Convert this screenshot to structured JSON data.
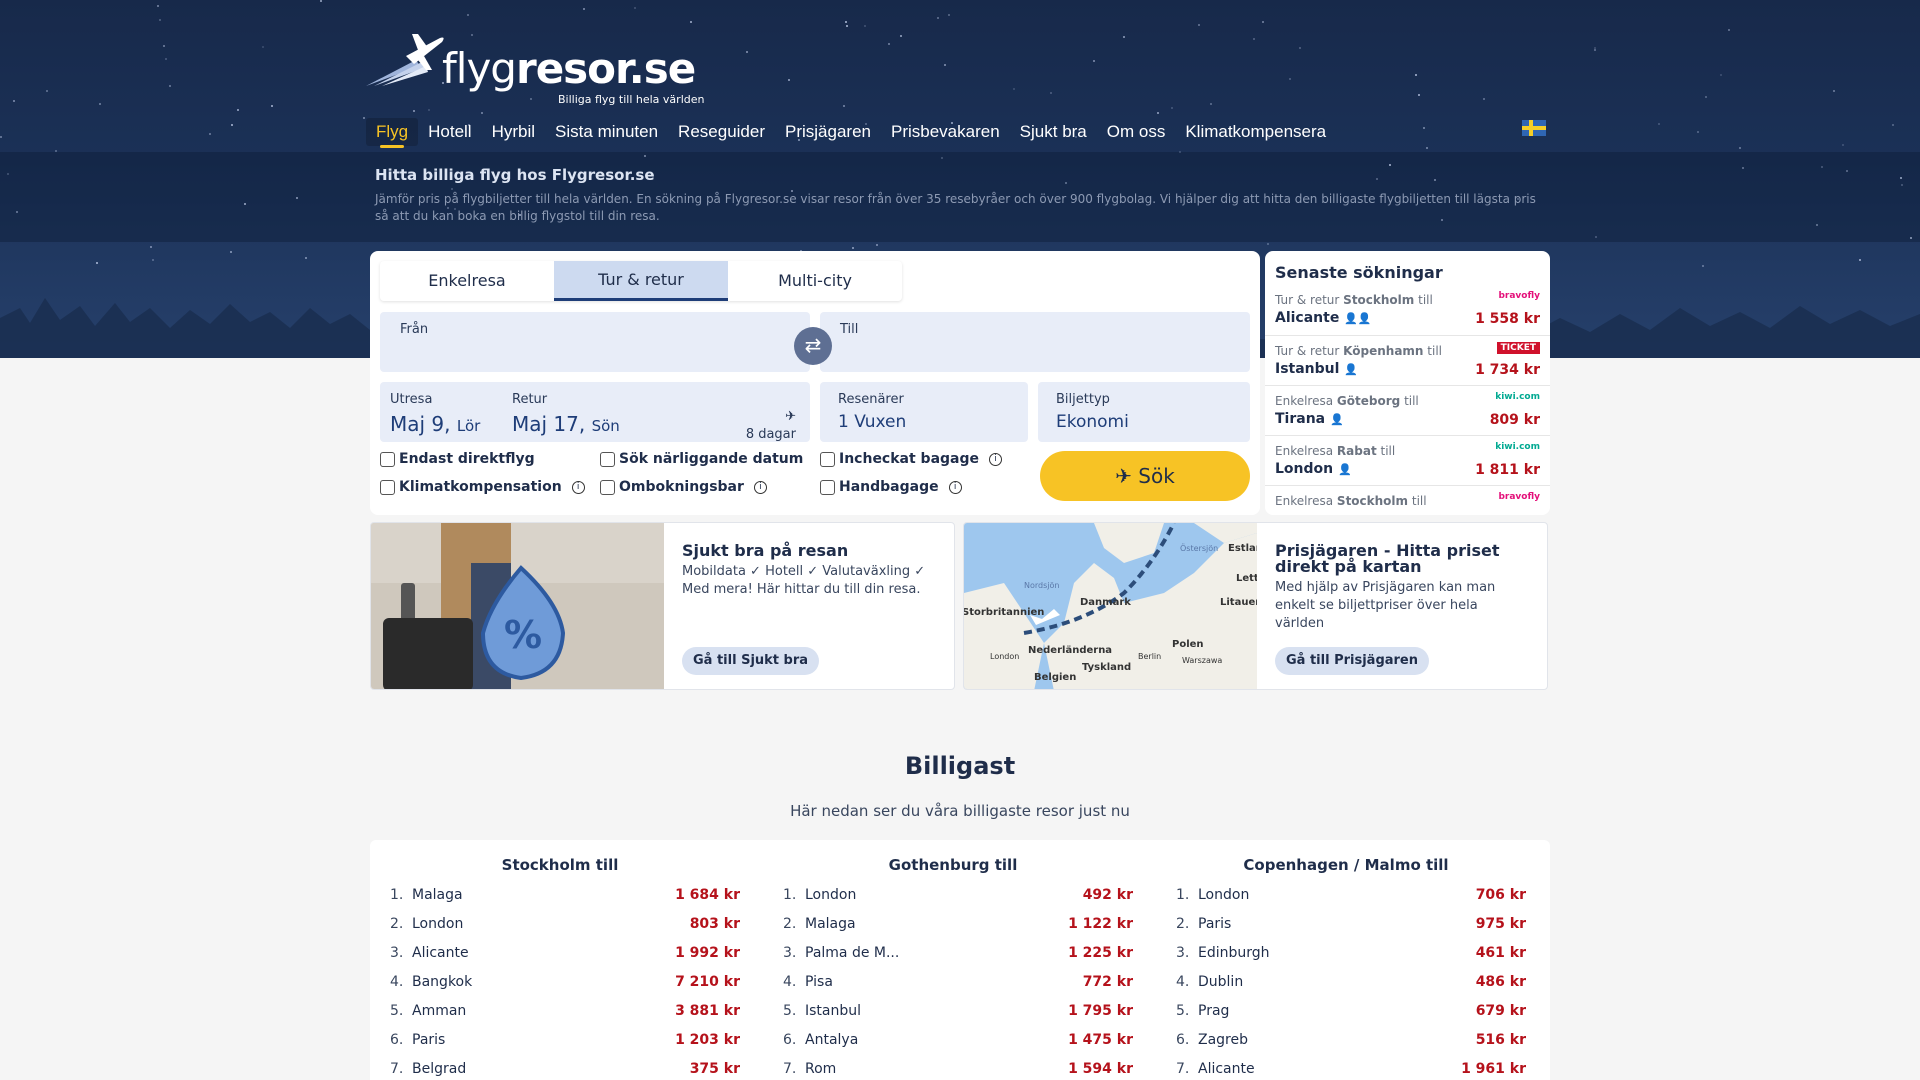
{
  "brand": {
    "name_light": "flyg",
    "name_bold": "resor.se",
    "tagline": "Billiga flyg till hela världen"
  },
  "nav": {
    "items": [
      "Flyg",
      "Hotell",
      "Hyrbil",
      "Sista minuten",
      "Reseguider",
      "Prisjägaren",
      "Prisbevakaren",
      "Sjukt bra",
      "Om oss",
      "Klimatkompensera"
    ],
    "active": "Flyg"
  },
  "intro": {
    "title": "Hitta billiga flyg hos Flygresor.se",
    "text": "Jämför pris på flygbiljetter till hela världen. En sökning på Flygresor.se visar resor från över 35 resebyråer och över 900 flygbolag. Vi hjälper dig att hitta den billigaste flygbiljetten till lägsta pris så att du kan boka en billig flygstol till din resa."
  },
  "search": {
    "tabs": [
      "Enkelresa",
      "Tur & retur",
      "Multi-city"
    ],
    "active_tab": "Tur & retur",
    "from_label": "Från",
    "to_label": "Till",
    "outbound_label": "Utresa",
    "outbound_date": "Maj 9,",
    "outbound_day": "Lör",
    "return_label": "Retur",
    "return_date": "Maj 17,",
    "return_day": "Sön",
    "trip_length": "8 dagar",
    "travellers_label": "Resenärer",
    "travellers_value": "1 Vuxen",
    "ticket_label": "Biljettyp",
    "ticket_value": "Ekonomi",
    "options": [
      "Endast direktflyg",
      "Sök närliggande datum",
      "Incheckat bagage",
      "Klimatkompensation",
      "Ombokningsbar",
      "Handbagage"
    ],
    "search_button": "Sök"
  },
  "recent": {
    "title": "Senaste sökningar",
    "rows": [
      {
        "type": "Tur & retur",
        "origin": "Stockholm",
        "to_word": "till",
        "dest": "Alicante",
        "persons": "2",
        "agency": "bravofly",
        "price": "1 558 kr"
      },
      {
        "type": "Tur & retur",
        "origin": "Köpenhamn",
        "to_word": "till",
        "dest": "Istanbul",
        "persons": "1",
        "agency": "TICKET",
        "price": "1 734 kr"
      },
      {
        "type": "Enkelresa",
        "origin": "Göteborg",
        "to_word": "till",
        "dest": "Tirana",
        "persons": "1",
        "agency": "kiwi.com",
        "price": "809 kr"
      },
      {
        "type": "Enkelresa",
        "origin": "Rabat",
        "to_word": "till",
        "dest": "London",
        "persons": "1",
        "agency": "kiwi.com",
        "price": "1 811 kr"
      },
      {
        "type": "Enkelresa",
        "origin": "Stockholm",
        "to_word": "till",
        "dest": "",
        "persons": "",
        "agency": "bravofly",
        "price": ""
      }
    ]
  },
  "promos": [
    {
      "title": "Sjukt bra på resan",
      "text": "Mobildata ✓ Hotell ✓ Valutaväxling ✓ Med mera! Här hittar du till din resa.",
      "button": "Gå till Sjukt bra"
    },
    {
      "title": "Prisjägaren - Hitta priset direkt på kartan",
      "text": "Med hjälp av Prisjägaren kan man enkelt se biljettpriser över hela världen",
      "button": "Gå till Prisjägaren",
      "map_labels": [
        "Östersjön",
        "Nordsjön",
        "Danmark",
        "Estland",
        "Lettland",
        "Litauen",
        "Storbritannien",
        "Nederländerna",
        "London",
        "Berlin",
        "Polen",
        "Warszawa",
        "Belgien",
        "Tyskland"
      ]
    }
  ],
  "cheapest": {
    "title": "Billigast",
    "subtitle": "Här nedan ser du våra billigaste resor just nu",
    "columns": [
      {
        "title": "Stockholm till",
        "routes": [
          {
            "city": "Malaga",
            "price": "1 684 kr"
          },
          {
            "city": "London",
            "price": "803 kr"
          },
          {
            "city": "Alicante",
            "price": "1 992 kr"
          },
          {
            "city": "Bangkok",
            "price": "7 210 kr"
          },
          {
            "city": "Amman",
            "price": "3 881 kr"
          },
          {
            "city": "Paris",
            "price": "1 203 kr"
          },
          {
            "city": "Belgrad",
            "price": "375 kr"
          }
        ]
      },
      {
        "title": "Gothenburg till",
        "routes": [
          {
            "city": "London",
            "price": "492 kr"
          },
          {
            "city": "Malaga",
            "price": "1 122 kr"
          },
          {
            "city": "Palma de M...",
            "price": "1 225 kr"
          },
          {
            "city": "Pisa",
            "price": "772 kr"
          },
          {
            "city": "Istanbul",
            "price": "1 795 kr"
          },
          {
            "city": "Antalya",
            "price": "1 475 kr"
          },
          {
            "city": "Rom",
            "price": "1 594 kr"
          }
        ]
      },
      {
        "title": "Copenhagen / Malmo till",
        "routes": [
          {
            "city": "London",
            "price": "706 kr"
          },
          {
            "city": "Paris",
            "price": "975 kr"
          },
          {
            "city": "Edinburgh",
            "price": "461 kr"
          },
          {
            "city": "Dublin",
            "price": "486 kr"
          },
          {
            "city": "Prag",
            "price": "679 kr"
          },
          {
            "city": "Zagreb",
            "price": "516 kr"
          },
          {
            "city": "Alicante",
            "price": "1 961 kr"
          }
        ]
      }
    ]
  },
  "colors": {
    "navy": "#1f2d4a",
    "accent": "#f7c325",
    "price": "#b5121b",
    "field": "#e8edf8"
  }
}
